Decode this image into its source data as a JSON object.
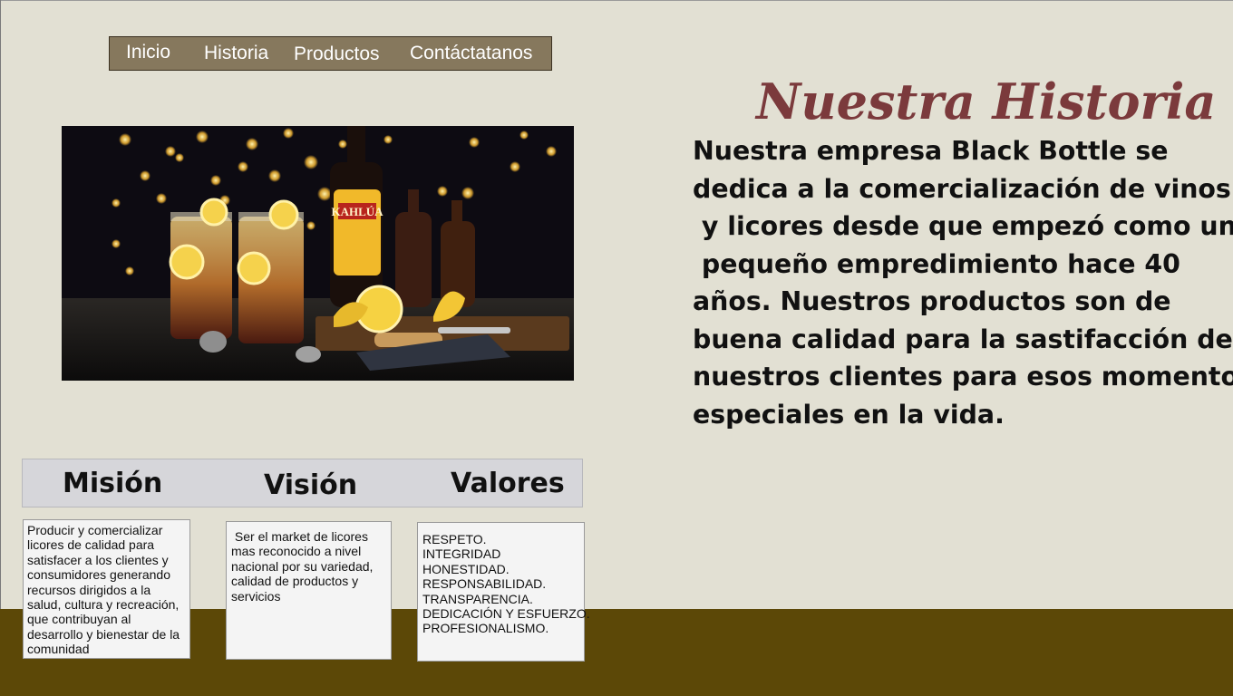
{
  "nav": {
    "items": [
      {
        "label": "Inicio"
      },
      {
        "label": "Historia"
      },
      {
        "label": "Productos"
      },
      {
        "label": "Contáctatanos"
      }
    ]
  },
  "hero_image": {
    "bottle_label": "KAHLÚA"
  },
  "heading": "Nuestra Historia",
  "intro_lines": [
    "Nuestra empresa Black Bottle se",
    "dedica a la comercialización de vinos",
    " y licores desde que empezó como un",
    " pequeño empredimiento hace 40",
    "años. Nuestros productos son de",
    "buena calidad para la sastifacción de",
    "nuestros clientes para esos momentos",
    "especiales en la vida."
  ],
  "pillars": [
    {
      "title": "Misión",
      "lines": [
        "Producir y comercializar",
        "licores de calidad para",
        "satisfacer a los clientes y",
        "consumidores generando",
        "recursos dirigidos a la",
        "salud, cultura y recreación,",
        "que contribuyan al",
        "desarrollo y bienestar de la",
        "comunidad"
      ]
    },
    {
      "title": "Visión",
      "lines": [
        " Ser el market de licores",
        "mas reconocido a nivel",
        "nacional por su variedad,",
        "calidad de productos y",
        "servicios"
      ]
    },
    {
      "title": "Valores",
      "lines": [
        "RESPETO.",
        "INTEGRIDAD",
        "HONESTIDAD.",
        "RESPONSABILIDAD.",
        "TRANSPARENCIA.",
        "DEDICACIÓN Y ESFUERZO.",
        "PROFESIONALISMO."
      ]
    }
  ],
  "colors": {
    "background": "#e2e0d3",
    "nav_background": "#86785d",
    "heading": "#7b3a3c",
    "footer_band": "#5c4807",
    "pillars_bar": "#d6d6da",
    "card_background": "#f4f4f4"
  }
}
